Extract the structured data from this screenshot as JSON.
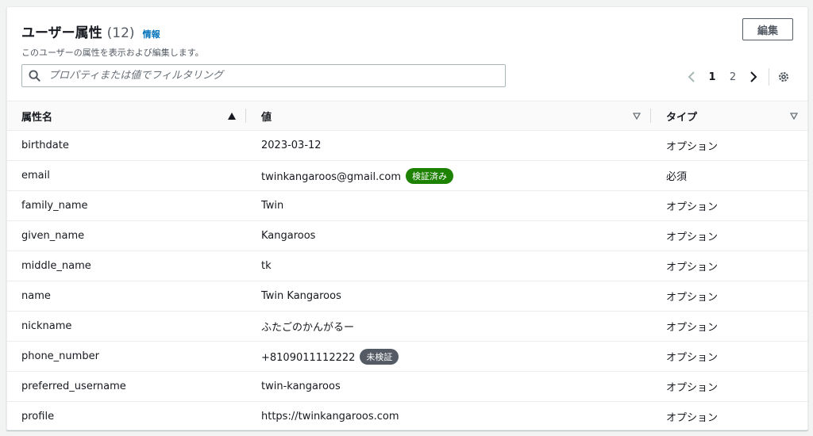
{
  "header": {
    "title": "ユーザー属性",
    "count": "(12)",
    "info": "情報",
    "description": "このユーザーの属性を表示および編集します。",
    "edit_label": "編集"
  },
  "search": {
    "placeholder": "プロパティまたは値でフィルタリング",
    "value": ""
  },
  "pagination": {
    "pages": [
      "1",
      "2"
    ],
    "current": "1"
  },
  "table": {
    "columns": [
      "属性名",
      "値",
      "タイプ"
    ],
    "rows": [
      {
        "name": "birthdate",
        "value": "2023-03-12",
        "badge": "",
        "type": "オプション"
      },
      {
        "name": "email",
        "value": "twinkangaroos@gmail.com",
        "badge": "検証済み",
        "badge_color": "#1d8102",
        "type": "必須"
      },
      {
        "name": "family_name",
        "value": "Twin",
        "badge": "",
        "type": "オプション"
      },
      {
        "name": "given_name",
        "value": "Kangaroos",
        "badge": "",
        "type": "オプション"
      },
      {
        "name": "middle_name",
        "value": "tk",
        "badge": "",
        "type": "オプション"
      },
      {
        "name": "name",
        "value": "Twin Kangaroos",
        "badge": "",
        "type": "オプション"
      },
      {
        "name": "nickname",
        "value": "ふたごのかんがるー",
        "badge": "",
        "type": "オプション"
      },
      {
        "name": "phone_number",
        "value": "+8109011112222",
        "badge": "未検証",
        "badge_color": "#545b64",
        "type": "オプション"
      },
      {
        "name": "preferred_username",
        "value": "twin-kangaroos",
        "badge": "",
        "type": "オプション"
      },
      {
        "name": "profile",
        "value": "https://twinkangaroos.com",
        "badge": "",
        "type": "オプション"
      }
    ]
  },
  "colors": {
    "link": "#0073bb",
    "verified": "#1d8102",
    "unverified": "#545b64"
  }
}
